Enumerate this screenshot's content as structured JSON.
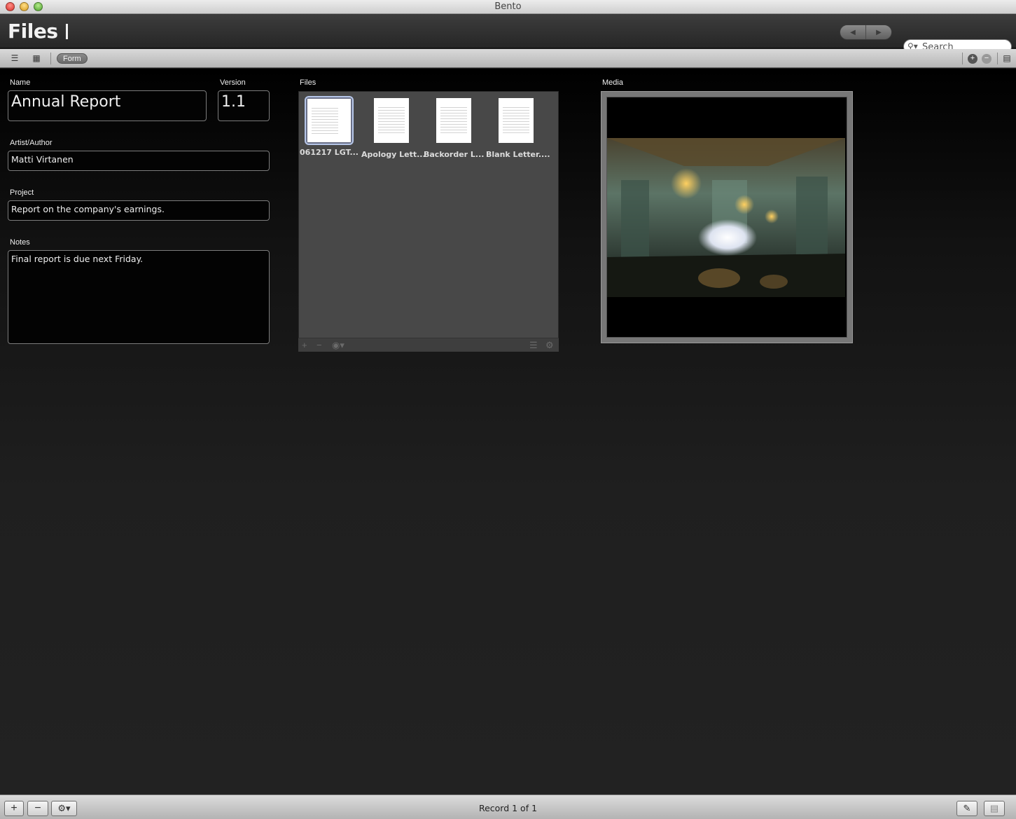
{
  "window": {
    "title": "Bento"
  },
  "header": {
    "library_title": "Files",
    "search": {
      "placeholder": "Search",
      "value": ""
    }
  },
  "viewbar": {
    "form_label": "Form"
  },
  "form": {
    "name": {
      "label": "Name",
      "value": "Annual Report"
    },
    "version": {
      "label": "Version",
      "value": "1.1"
    },
    "artist": {
      "label": "Artist/Author",
      "value": "Matti Virtanen"
    },
    "project": {
      "label": "Project",
      "value": "Report on the company's earnings."
    },
    "notes": {
      "label": "Notes",
      "value": "Final report is due next Friday."
    }
  },
  "files": {
    "label": "Files",
    "items": [
      {
        "name": "061217 LGT..."
      },
      {
        "name": "Apology Lett..."
      },
      {
        "name": "Backorder L..."
      },
      {
        "name": "Blank Letter...."
      }
    ]
  },
  "media": {
    "label": "Media"
  },
  "status": {
    "record": "Record 1 of 1"
  }
}
